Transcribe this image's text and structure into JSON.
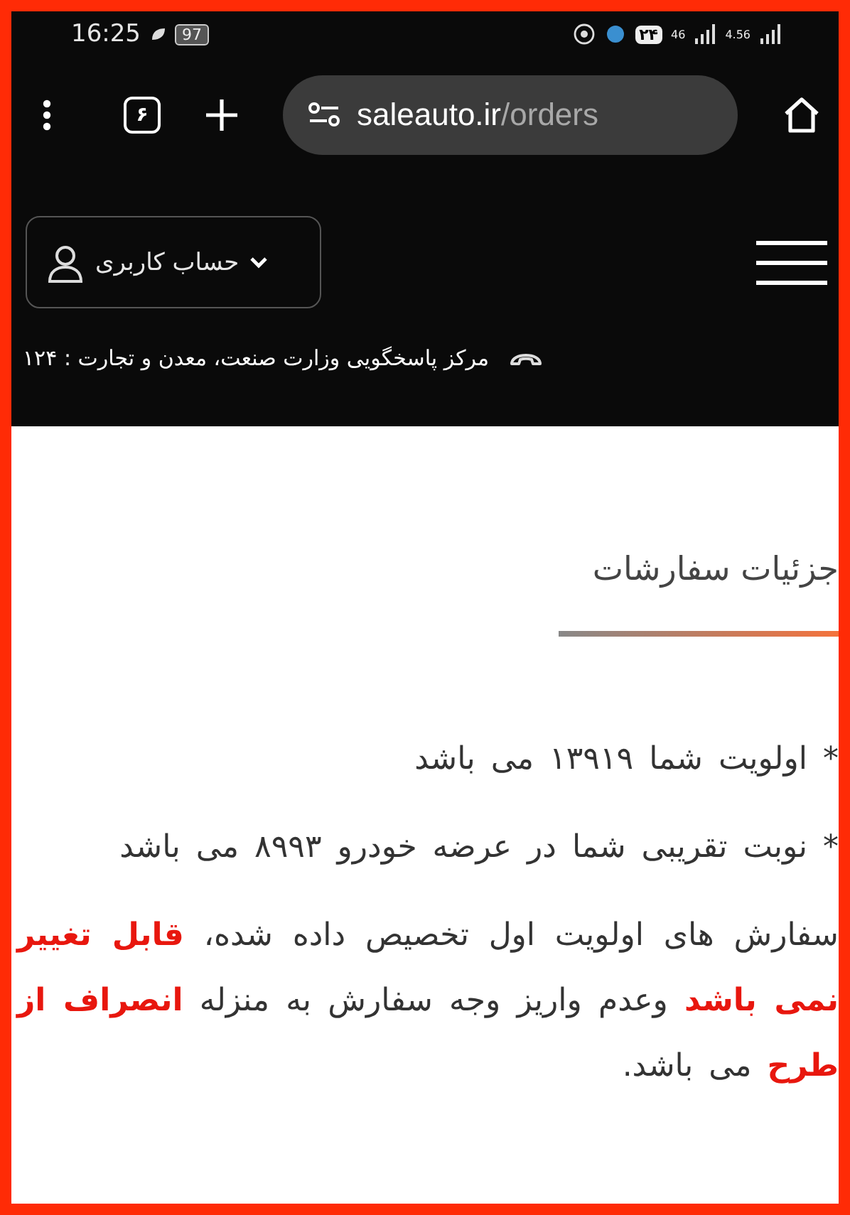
{
  "status_bar": {
    "time": "16:25",
    "battery": "97",
    "badge": "۲۴",
    "network_1": "46",
    "network_2": "4.56"
  },
  "browser": {
    "tab_count": "۶",
    "url_host": "saleauto.ir",
    "url_path": "/orders"
  },
  "header": {
    "account_label": "حساب کاربری",
    "support_line": "مرکز پاسخگویی وزارت صنعت، معدن و تجارت : ۱۲۴"
  },
  "page": {
    "title": "جزئیات سفارشات",
    "paragraphs": [
      [
        {
          "text": "* اولویت شما ۱۳۹۱۹ می باشد",
          "highlight": false
        }
      ],
      [
        {
          "text": "* نوبت تقریبی شما در عرضه خودرو ۸۹۹۳ می باشد",
          "highlight": false
        }
      ],
      [
        {
          "text": "سفارش های اولویت اول تخصیص داده شده، ",
          "highlight": false
        },
        {
          "text": "قابل تغییر نمی باشد",
          "highlight": true
        },
        {
          "text": " وعدم واریز وجه سفارش به منزله ",
          "highlight": false
        },
        {
          "text": "انصراف از طرح",
          "highlight": true
        },
        {
          "text": " می باشد.",
          "highlight": false
        }
      ]
    ]
  }
}
